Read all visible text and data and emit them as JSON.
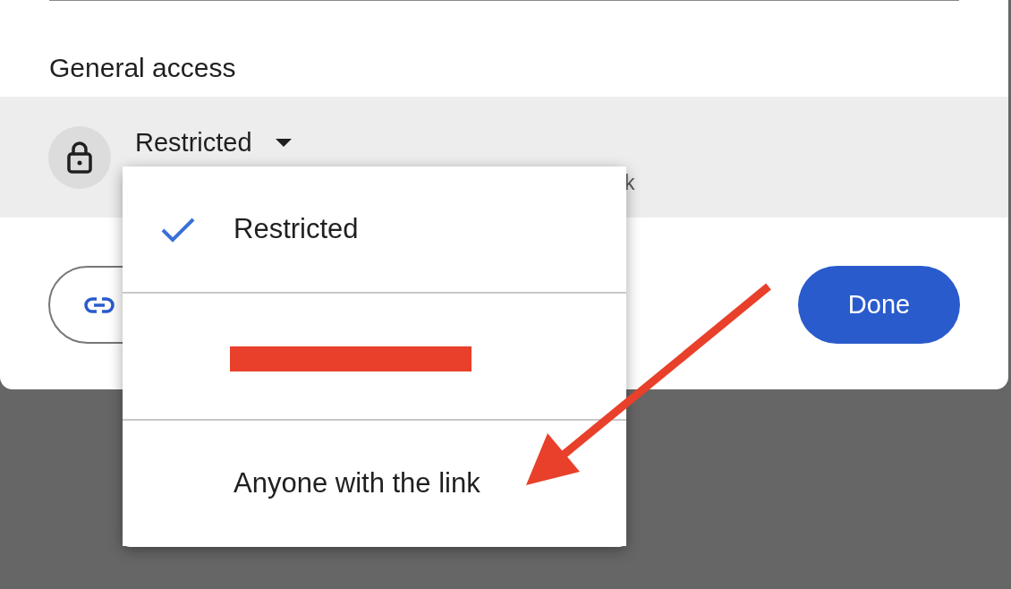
{
  "section_title": "General access",
  "access": {
    "value": "Restricted",
    "description_visible": "k"
  },
  "menu": {
    "options": [
      {
        "kind": "text",
        "label": "Restricted",
        "selected": true
      },
      {
        "kind": "redacted",
        "selected": false
      },
      {
        "kind": "text",
        "label": "Anyone with the link",
        "selected": false
      }
    ]
  },
  "done_button": "Done",
  "annotation": {
    "kind": "arrow"
  }
}
